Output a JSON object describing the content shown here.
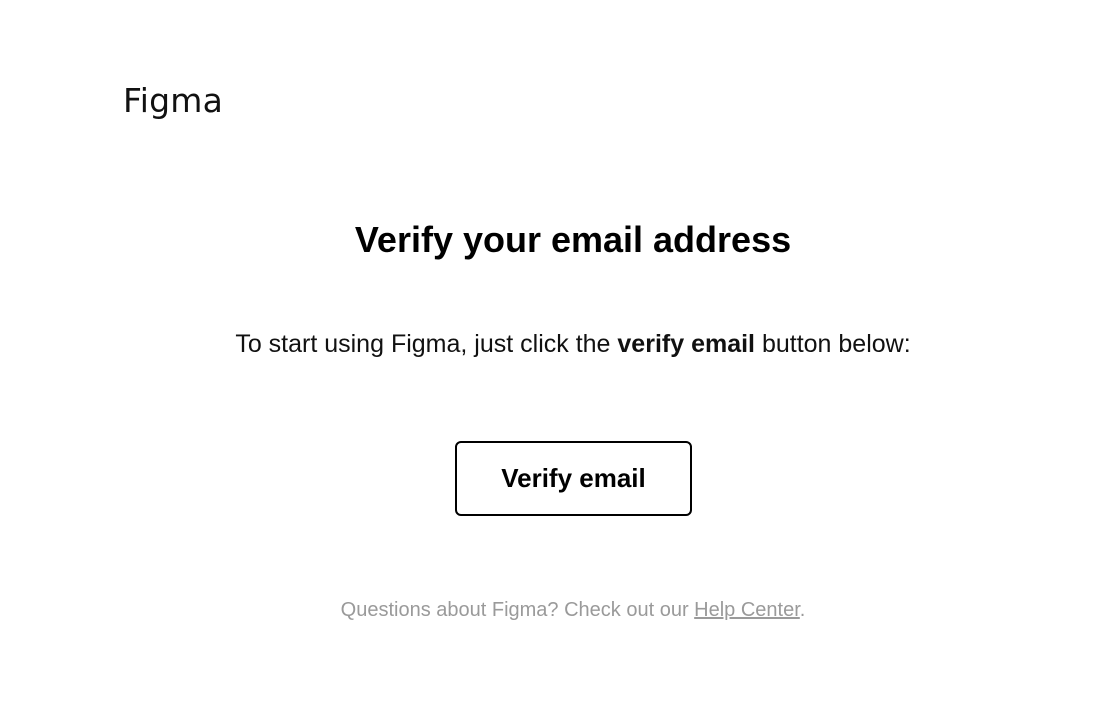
{
  "brand": {
    "logo_text": "Figma"
  },
  "main": {
    "heading": "Verify your email address",
    "intro_prefix": "To start using Figma, just click the ",
    "intro_emphasis": "verify email",
    "intro_suffix": " button below:",
    "verify_button_label": "Verify email"
  },
  "footer": {
    "prefix": "Questions about Figma? Check out our ",
    "link_text": "Help Center",
    "suffix": "."
  },
  "colors": {
    "text": "#000000",
    "muted_text": "#9a9a9a",
    "background": "#ffffff"
  }
}
